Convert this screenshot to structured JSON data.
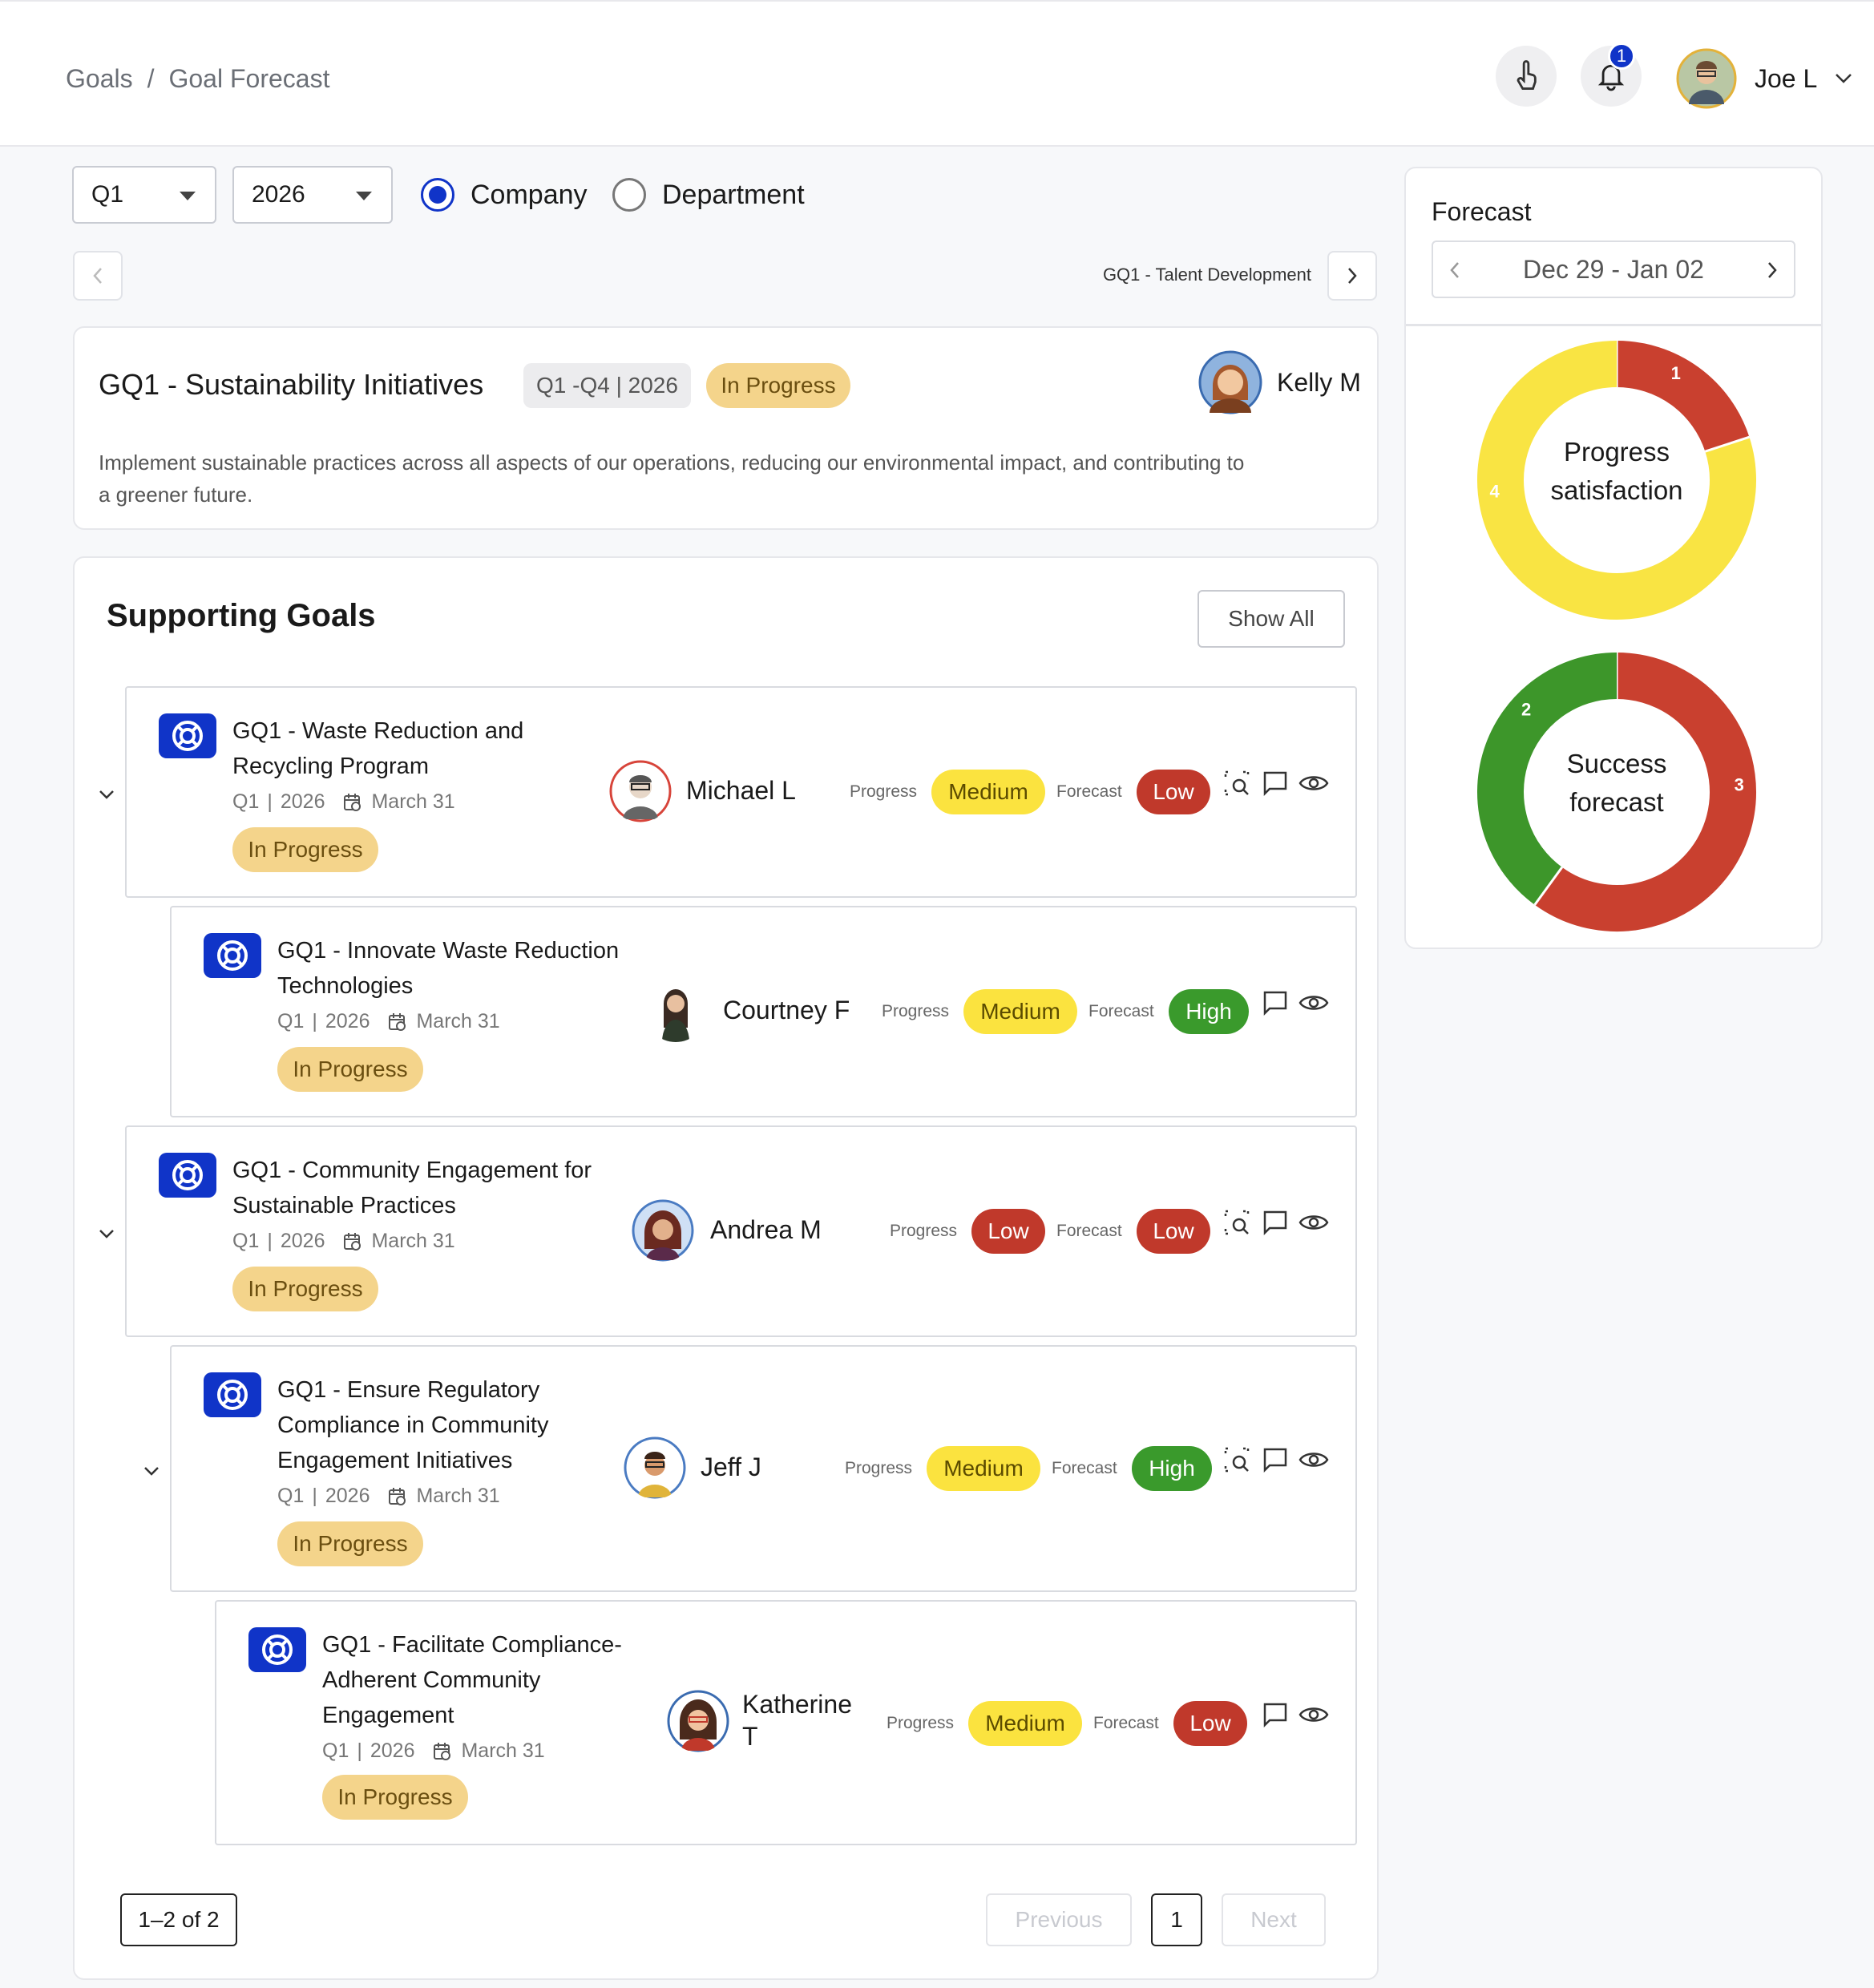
{
  "header": {
    "breadcrumb": [
      "Goals",
      "/",
      "Goal Forecast"
    ],
    "notification_count": "1",
    "user_name": "Joe L"
  },
  "filters": {
    "quarter": "Q1",
    "year": "2026",
    "scope_options": [
      "Company",
      "Department"
    ],
    "selected_scope": "Company"
  },
  "nav": {
    "next_goal_label": "GQ1 - Talent Development"
  },
  "goal": {
    "title": "GQ1 - Sustainability Initiatives",
    "period": "Q1 -Q4 | 2026",
    "status": "In Progress",
    "owner": "Kelly M",
    "description": "Implement sustainable practices across all aspects of our operations, reducing our environmental impact, and contributing to a greener future."
  },
  "supporting": {
    "title": "Supporting Goals",
    "show_all_label": "Show All",
    "labels": {
      "progress": "Progress",
      "forecast": "Forecast"
    },
    "rows": [
      {
        "title": "GQ1 - Waste Reduction and Recycling Program",
        "quarter": "Q1",
        "year": "2026",
        "due": "March 31",
        "status": "In Progress",
        "owner": "Michael L",
        "progress": "Medium",
        "forecast": "Low"
      },
      {
        "title": "GQ1 - Innovate Waste Reduction Technologies",
        "quarter": "Q1",
        "year": "2026",
        "due": "March 31",
        "status": "In Progress",
        "owner": "Courtney F",
        "progress": "Medium",
        "forecast": "High"
      },
      {
        "title": "GQ1 - Community Engagement for Sustainable Practices",
        "quarter": "Q1",
        "year": "2026",
        "due": "March 31",
        "status": "In Progress",
        "owner": "Andrea M",
        "progress": "Low",
        "forecast": "Low"
      },
      {
        "title": "GQ1 - Ensure Regulatory Compliance in Community Engagement Initiatives",
        "quarter": "Q1",
        "year": "2026",
        "due": "March 31",
        "status": "In Progress",
        "owner": "Jeff J",
        "progress": "Medium",
        "forecast": "High"
      },
      {
        "title": "GQ1 - Facilitate Compliance-Adherent Community Engagement",
        "quarter": "Q1",
        "year": "2026",
        "due": "March 31",
        "status": "In Progress",
        "owner": "Katherine T",
        "progress": "Medium",
        "forecast": "Low"
      }
    ],
    "pagination": {
      "range": "1–2 of 2",
      "previous": "Previous",
      "page": "1",
      "next": "Next"
    }
  },
  "forecast": {
    "title": "Forecast",
    "range": "Dec 29 - Jan 02",
    "charts": [
      {
        "label_line1": "Progress",
        "label_line2": "satisfaction",
        "segments": [
          {
            "value": 1,
            "label": "1",
            "color": "#c9402f"
          },
          {
            "value": 4,
            "label": "4",
            "color": "#f9e443"
          }
        ]
      },
      {
        "label_line1": "Success",
        "label_line2": "forecast",
        "segments": [
          {
            "value": 3,
            "label": "3",
            "color": "#c9402f"
          },
          {
            "value": 2,
            "label": "2",
            "color": "#3d962a"
          }
        ]
      }
    ]
  },
  "colors": {
    "accent": "#1034c8",
    "in_progress": "#f4d48b",
    "medium": "#fbe33f",
    "low": "#c0392b",
    "high": "#3a9a2c"
  }
}
